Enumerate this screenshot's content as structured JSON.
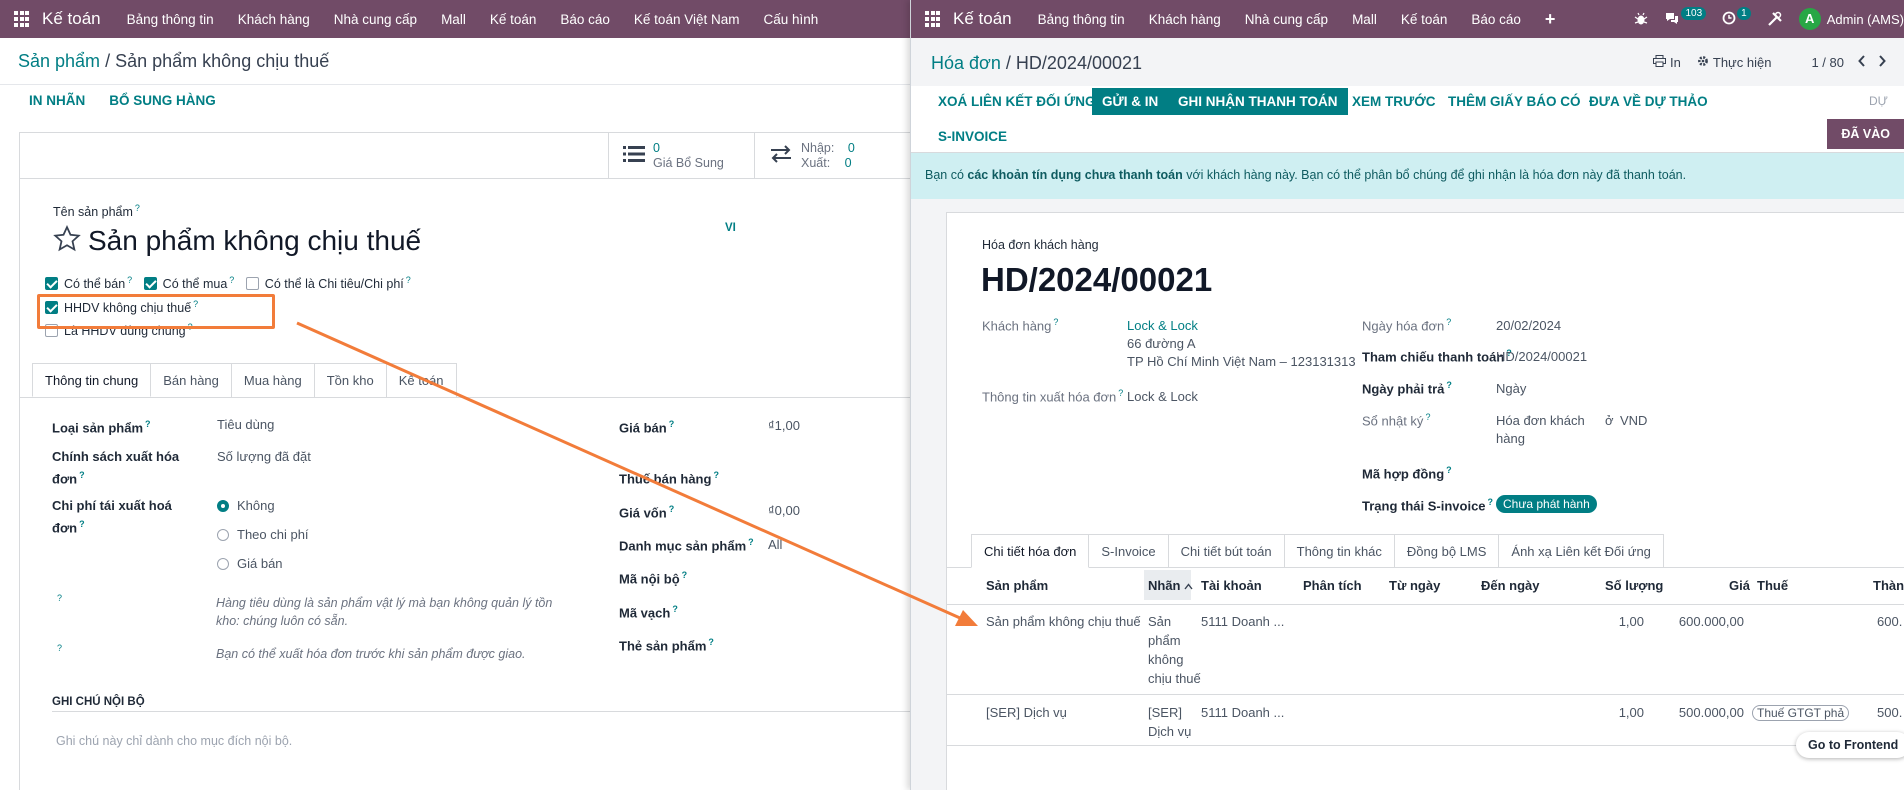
{
  "left": {
    "navbar": {
      "app": "Kế toán",
      "items": [
        "Bảng thông tin",
        "Khách hàng",
        "Nhà cung cấp",
        "Mall",
        "Kế toán",
        "Báo cáo",
        "Kế toán Việt Nam",
        "Cấu hình"
      ]
    },
    "breadcrumb": {
      "parent": "Sản phẩm",
      "sep": "/",
      "current": "Sản phẩm không chịu thuế"
    },
    "actions": [
      "IN NHÃN",
      "BỔ SUNG HÀNG"
    ],
    "stats": {
      "supply_count": "0",
      "supply_label": "Giá Bổ Sung",
      "in_label": "Nhập:",
      "in_val": "0",
      "out_label": "Xuất:",
      "out_val": "0"
    },
    "product_name_label": "Tên sản phẩm",
    "product_name": "Sản phẩm không chịu thuế",
    "lang": "VI",
    "checks": {
      "sale": "Có thể bán",
      "purchase": "Có thể mua",
      "expense": "Có thể là Chi tiêu/Chi phí",
      "notax": "HHDV không chịu thuế",
      "common": "Là HHDV dùng chung"
    },
    "tabs": [
      "Thông tin chung",
      "Bán hàng",
      "Mua hàng",
      "Tồn kho",
      "Kế toán"
    ],
    "fields": {
      "type_label": "Loại sản phẩm",
      "type_val": "Tiêu dùng",
      "policy_label1": "Chính sách xuất hóa",
      "policy_label2": "đơn",
      "policy_val": "Số lượng đã đặt",
      "reinv_label1": "Chi phí tái xuất hoá",
      "reinv_label2": "đơn",
      "reinv_opts": [
        "Không",
        "Theo chi phí",
        "Giá bán"
      ],
      "note1a": "Hàng tiêu dùng là sản phẩm vật lý mà bạn không quản lý tồn",
      "note1b": "kho: chúng luôn có sẵn.",
      "note2": "Bạn có thể xuất hóa đơn trước khi sản phẩm được giao.",
      "price_label": "Giá bán",
      "price_val": "₫1,00",
      "saletax_label": "Thuế bán hàng",
      "cost_label": "Giá vốn",
      "cost_val": "₫0,00",
      "categ_label": "Danh mục sản phẩm",
      "categ_val": "All",
      "ref_label": "Mã nội bộ",
      "barcode_label": "Mã vạch",
      "tags_label": "Thẻ sản phẩm"
    },
    "internal_note_title": "GHI CHÚ NỘI BỘ",
    "internal_note_placeholder": "Ghi chú này chỉ dành cho mục đích nội bộ."
  },
  "right": {
    "navbar": {
      "app": "Kế toán",
      "items": [
        "Bảng thông tin",
        "Khách hàng",
        "Nhà cung cấp",
        "Mall",
        "Kế toán",
        "Báo cáo"
      ],
      "msg_count": "103",
      "activity_count": "1",
      "user": "Admin (AMS)"
    },
    "breadcrumb": {
      "parent": "Hóa đơn",
      "sep": "/",
      "current": "HD/2024/00021"
    },
    "tools": {
      "print": "In",
      "action": "Thực hiện",
      "pager": "1 / 80"
    },
    "actions": [
      "XOÁ LIÊN KẾT ĐỐI ỨNG",
      "GỬI & IN",
      "GHI NHẬN THANH TOÁN",
      "XEM TRƯỚC",
      "THÊM GIẤY BÁO CÓ",
      "ĐƯA VỀ DỰ THẢO",
      "S-INVOICE"
    ],
    "draft_status": "DỰ",
    "posted_status": "ĐÃ VÀO",
    "alert": {
      "pre": "Bạn có ",
      "strong": "các khoản tín dụng chưa thanh toán",
      "post": " với khách hàng này. Bạn có thể phân bổ chúng để ghi nhận là hóa đơn này đã thanh toán."
    },
    "invoice": {
      "type": "Hóa đơn khách hàng",
      "number": "HD/2024/00021",
      "customer_label": "Khách hàng",
      "customer": "Lock & Lock",
      "addr1": "66 đường A",
      "addr2": "TP Hồ Chí Minh Việt Nam – 123131313",
      "billinfo_label": "Thông tin xuất hóa đơn",
      "billinfo": "Lock & Lock",
      "date_label": "Ngày hóa đơn",
      "date": "20/02/2024",
      "payref_label": "Tham chiếu thanh toán",
      "payref": "HD/2024/00021",
      "due_label": "Ngày phải trả",
      "due": "Ngày",
      "journal_label": "Sổ nhật ký",
      "journal1": "Hóa đơn khách",
      "journal2": "hàng",
      "journal_in": "ở",
      "currency": "VND",
      "contract_label": "Mã hợp đồng",
      "sinv_status_label": "Trạng thái S-invoice",
      "sinv_status": "Chưa phát hành"
    },
    "tabs": [
      "Chi tiết hóa đơn",
      "S-Invoice",
      "Chi tiết bút toán",
      "Thông tin khác",
      "Đồng bộ LMS",
      "Ánh xạ Liên kết Đối ứng"
    ],
    "columns": [
      "Sản phẩm",
      "Nhãn",
      "Tài khoản",
      "Phân tích",
      "Từ ngày",
      "Đến ngày",
      "Số lượng",
      "Giá",
      "Thuế",
      "Thành"
    ],
    "lines": [
      {
        "product": "Sản phẩm không chịu thuế",
        "label": [
          "Sản",
          "phẩm",
          "không",
          "chịu thuế"
        ],
        "account": "5111 Doanh ...",
        "qty": "1,00",
        "price": "600.000,00",
        "tax": "",
        "subtotal": "600."
      },
      {
        "product": "[SER] Dịch vụ",
        "label": [
          "[SER]",
          "Dịch vụ"
        ],
        "account": "5111 Doanh ...",
        "qty": "1,00",
        "price": "500.000,00",
        "tax": "Thuế GTGT phả",
        "subtotal": "500."
      }
    ],
    "frontend_btn": "Go to Frontend"
  },
  "colors": {
    "brand": "#714b67",
    "accent": "#017e84",
    "annotation": "#f27c3a"
  }
}
